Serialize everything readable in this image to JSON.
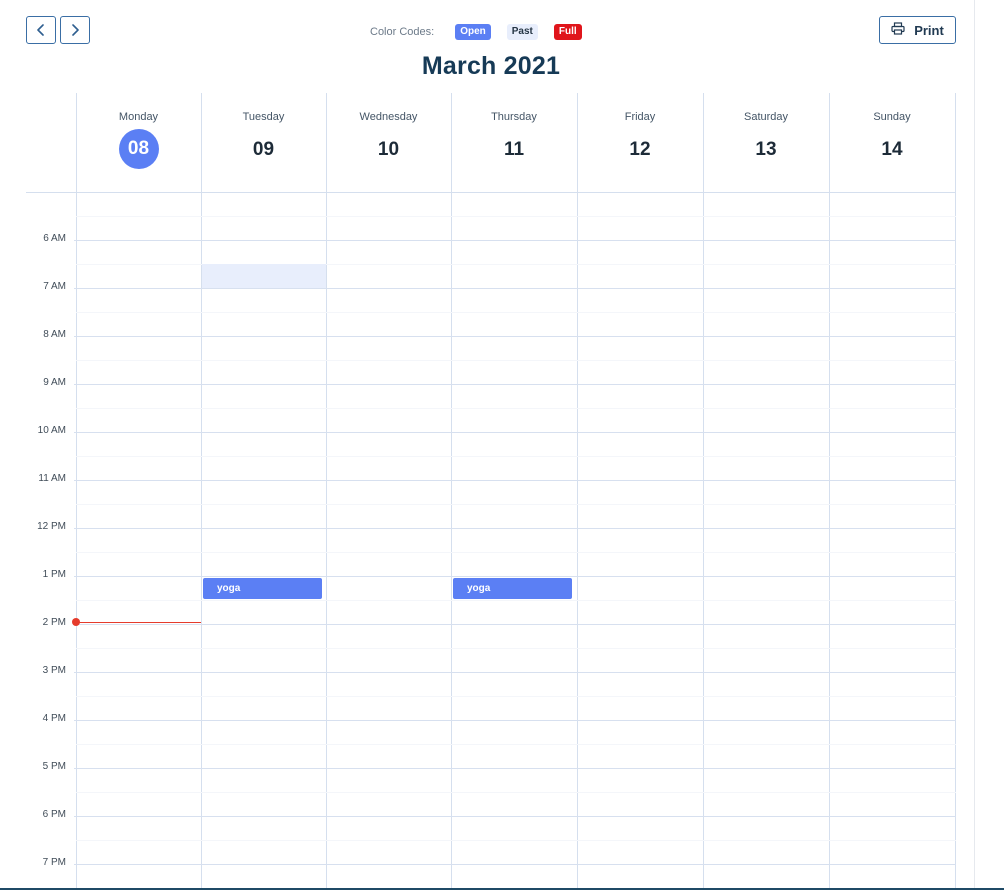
{
  "toolbar": {
    "prev_icon": "chevron-left-icon",
    "next_icon": "chevron-right-icon",
    "print_label": "Print",
    "print_icon": "printer-icon"
  },
  "legend": {
    "label": "Color Codes:",
    "open": "Open",
    "past": "Past",
    "full": "Full",
    "colors": {
      "open": "#5b7ff4",
      "past": "#e8eefc",
      "full": "#e0151b"
    }
  },
  "calendar": {
    "title": "March 2021",
    "days": [
      {
        "name": "Monday",
        "number": "08",
        "today": true
      },
      {
        "name": "Tuesday",
        "number": "09",
        "today": false
      },
      {
        "name": "Wednesday",
        "number": "10",
        "today": false
      },
      {
        "name": "Thursday",
        "number": "11",
        "today": false
      },
      {
        "name": "Friday",
        "number": "12",
        "today": false
      },
      {
        "name": "Saturday",
        "number": "13",
        "today": false
      },
      {
        "name": "Sunday",
        "number": "14",
        "today": false
      }
    ],
    "times": [
      "6 AM",
      "7 AM",
      "8 AM",
      "9 AM",
      "10 AM",
      "11 AM",
      "12 PM",
      "1 PM",
      "2 PM",
      "3 PM",
      "4 PM",
      "5 PM",
      "6 PM",
      "7 PM"
    ],
    "events": [
      {
        "title": "yoga",
        "day": "Tuesday",
        "starts": "1 PM"
      },
      {
        "title": "yoga",
        "day": "Thursday",
        "starts": "1 PM"
      }
    ],
    "past_slot": {
      "day": "Tuesday",
      "starts": "6:30 AM",
      "ends": "7 AM"
    },
    "current_time_day": "Monday",
    "accent_color": "#5b7ff4",
    "now_color": "#e53b2c"
  }
}
